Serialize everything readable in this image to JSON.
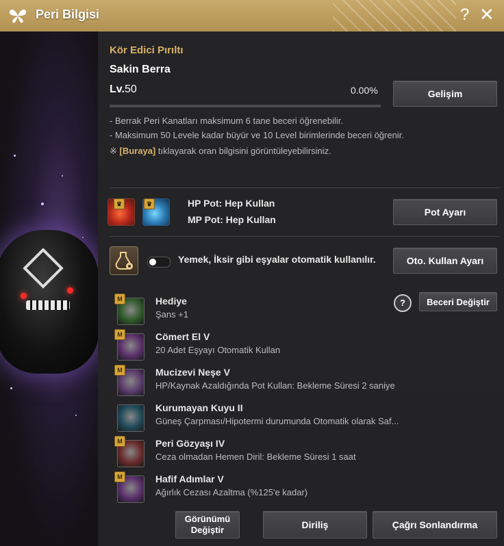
{
  "window": {
    "title": "Peri Bilgisi",
    "help_glyph": "?",
    "close_glyph": "✕"
  },
  "fairy": {
    "type_label": "Kör Edici Pırıltı",
    "name": "Sakin Berra",
    "level_prefix": "Lv.",
    "level": "50",
    "progress_text": "0.00%",
    "progress_value": 0.0,
    "growth_button": "Gelişim",
    "info_lines": [
      "- Berrak Peri Kanatları maksimum 6 tane beceri öğrenebilir.",
      "- Maksimum 50 Levele kadar büyür ve 10 Level birimlerinde beceri öğrenir."
    ],
    "note_prefix": "※ ",
    "note_link": "[Buraya]",
    "note_suffix": " tıklayarak oran bilgisini görüntüleyebilirsiniz."
  },
  "potions": {
    "hp_text": "HP Pot: Hep Kullan",
    "mp_text": "MP Pot: Hep Kullan",
    "button": "Pot Ayarı"
  },
  "auto_use": {
    "text": "Yemek, İksir gibi eşyalar otomatik kullanılır.",
    "enabled": false,
    "button": "Oto. Kullan Ayarı"
  },
  "skills_header": {
    "help_glyph": "?",
    "change_button": "Beceri Değiştir"
  },
  "skills": [
    {
      "badge": "M",
      "name": "Hediye",
      "desc": "Şans +1",
      "icon": "clover-icon",
      "color": "#2f5a2a"
    },
    {
      "badge": "M",
      "name": "Cömert El V",
      "desc": "20 Adet Eşyayı Otomatik Kullan",
      "icon": "fairy-icon",
      "color": "#5a2f6a"
    },
    {
      "badge": "M",
      "name": "Mucizevi Neşe V",
      "desc": "HP/Kaynak Azaldığında Pot Kullan: Bekleme Süresi 2 saniye",
      "icon": "potion-icon",
      "color": "#5a3a6a"
    },
    {
      "badge": "",
      "name": "Kurumayan Kuyu II",
      "desc": "Güneş Çarpması/Hipotermi durumunda Otomatik olarak Saf...",
      "icon": "bowl-icon",
      "color": "#1f4a5a"
    },
    {
      "badge": "M",
      "name": "Peri Gözyaşı IV",
      "desc": "Ceza olmadan Hemen Diril: Bekleme Süresi 1 saat",
      "icon": "tear-bottle-icon",
      "color": "#6a2a2a"
    },
    {
      "badge": "M",
      "name": "Hafif Adımlar V",
      "desc": "Ağırlık Cezası Azaltma (%125'e kadar)",
      "icon": "weight-icon",
      "color": "#5a2f6a"
    }
  ],
  "footer": {
    "appearance_button_line1": "Görünümü",
    "appearance_button_line2": "Değiştir",
    "revive_button": "Diriliş",
    "end_summon_button": "Çağrı Sonlandırma"
  },
  "colors": {
    "accent": "#d9b26a",
    "title_bar": "#c8aa6c"
  }
}
